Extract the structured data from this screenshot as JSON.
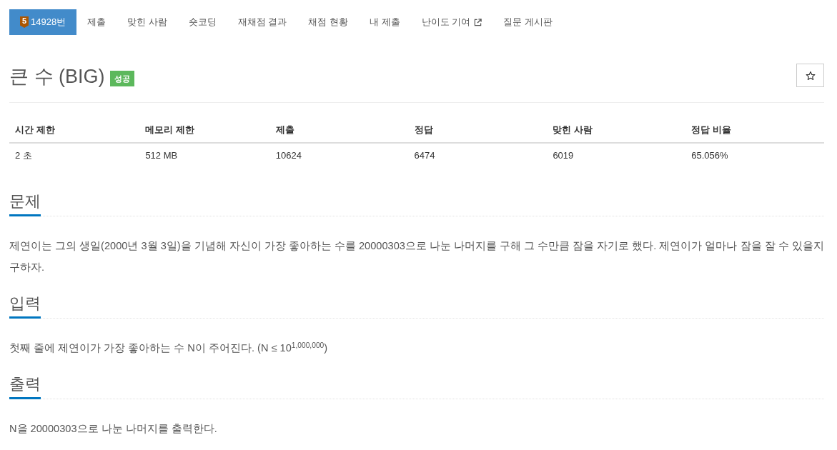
{
  "tabs": [
    {
      "label": "14928번",
      "tier": "5",
      "selected": true,
      "external": false
    },
    {
      "label": "제출",
      "selected": false,
      "external": false
    },
    {
      "label": "맞힌 사람",
      "selected": false,
      "external": false
    },
    {
      "label": "숏코딩",
      "selected": false,
      "external": false
    },
    {
      "label": "재채점 결과",
      "selected": false,
      "external": false
    },
    {
      "label": "채점 현황",
      "selected": false,
      "external": false
    },
    {
      "label": "내 제출",
      "selected": false,
      "external": false
    },
    {
      "label": "난이도 기여",
      "selected": false,
      "external": true
    },
    {
      "label": "질문 게시판",
      "selected": false,
      "external": false
    }
  ],
  "problem": {
    "title": "큰 수 (BIG)",
    "result_badge": "성공"
  },
  "info_table": {
    "columns": [
      "시간 제한",
      "메모리 제한",
      "제출",
      "정답",
      "맞힌 사람",
      "정답 비율"
    ],
    "rows": [
      [
        "2 초",
        "512 MB",
        "10624",
        "6474",
        "6019",
        "65.056%"
      ]
    ]
  },
  "sections": [
    {
      "heading": "문제",
      "text": "제연이는 그의 생일(2000년 3월 3일)을 기념해 자신이 가장 좋아하는 수를 20000303으로 나눈 나머지를 구해 그 수만큼 잠을 자기로 했다. 제연이가 얼마나 잠을 잘 수 있을지 구하자."
    },
    {
      "heading": "입력",
      "text": "첫째 줄에 제연이가 가장 좋아하는 수 N이 주어진다. (N ≤ 10$^{1,000,000}$)"
    },
    {
      "heading": "출력",
      "text": "N을 20000303으로 나눈 나머지를 출력한다."
    }
  ]
}
